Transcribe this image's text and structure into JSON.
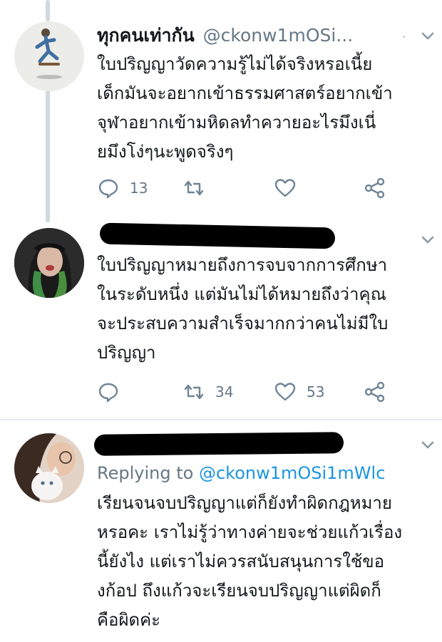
{
  "tweets": [
    {
      "display_name": "ทุกคนเท่ากัน",
      "handle": "@ckonw1mOSi...",
      "text": "ใบปริญญาวัดความรู้ไม่ได้จริงหรอเนี้ย\nเด็กมันจะอยากเข้าธรรมศาสตร์อยากเข้า\nจุฬาอยากเข้ามหิดลทำควายอะไรมึงเนี่\nยมึงโง่ๆนะพูดจริงๆ",
      "reply_count": "13",
      "retweet_count": "",
      "like_count": ""
    },
    {
      "text": "ใบปริญญาหมายถึงการจบจากการศึกษา\nในระดับหนึ่ง แต่มันไม่ได้หมายถึงว่าคุณ\nจะประสบความสำเร็จมากกว่าคนไม่มีใบ\nปริญญา",
      "reply_count": "",
      "retweet_count": "34",
      "like_count": "53"
    },
    {
      "replying_prefix": "Replying to",
      "replying_handle": "@ckonw1mOSi1mWlc",
      "text": "เรียนจนจบปริญญาแต่ก็ยังทำผิดกฎหมาย\nหรอคะ เราไม่รู้ว่าทางค่ายจะช่วยแก้วเรื่อง\nนี้ยังไง แต่เราไม่ควรสนับสนุนการใช้ขอ\nงก้อป ถึงแก้วจะเรียนจบปริญญาแต่ผิดก็\nคือผิดค่ะ"
    }
  ],
  "icons": {
    "reply": "reply-icon",
    "retweet": "retweet-icon",
    "like": "like-icon",
    "share": "share-icon",
    "menu": "chevron-down-icon"
  },
  "colors": {
    "text": "#14171a",
    "muted": "#657786",
    "link": "#1b95e0",
    "thread_line": "#cfd9de",
    "icon": "#6e8496"
  }
}
